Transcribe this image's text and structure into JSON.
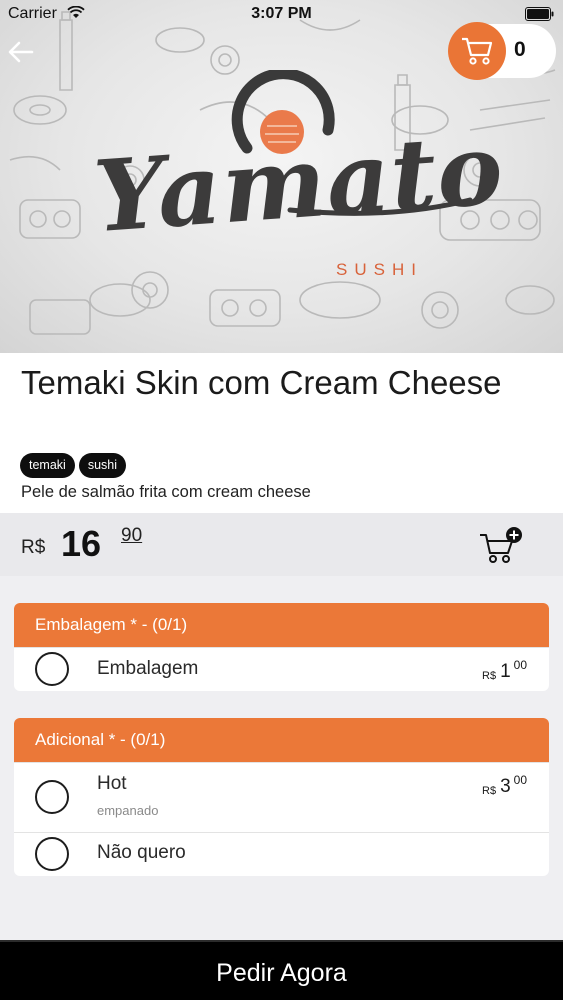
{
  "status_bar": {
    "carrier": "Carrier",
    "time": "3:07 PM"
  },
  "header": {
    "cart_count": "0"
  },
  "logo": {
    "word": "Yamato",
    "sub": "SUSHI"
  },
  "product": {
    "title": "Temaki Skin com Cream Cheese",
    "tags": [
      "temaki",
      "sushi"
    ],
    "description": "Pele de salmão frita com cream cheese",
    "price": {
      "currency": "R$",
      "integer": "16",
      "cents": "90"
    }
  },
  "option_groups": [
    {
      "header": "Embalagem * - (0/1)",
      "options": [
        {
          "name": "Embalagem",
          "subtitle": "",
          "price": {
            "currency": "R$",
            "integer": "1",
            "cents": "00"
          }
        }
      ]
    },
    {
      "header": "Adicional * - (0/1)",
      "options": [
        {
          "name": "Hot",
          "subtitle": "empanado",
          "price": {
            "currency": "R$",
            "integer": "3",
            "cents": "00"
          }
        },
        {
          "name": "Não quero",
          "subtitle": "",
          "price": null
        }
      ]
    }
  ],
  "footer": {
    "order_label": "Pedir Agora"
  },
  "colors": {
    "accent": "#eb7838",
    "dark": "#000000",
    "tag_bg": "#0e0e0e"
  }
}
